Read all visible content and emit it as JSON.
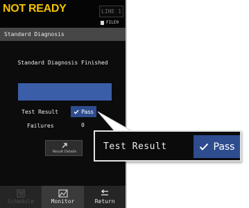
{
  "header": {
    "status_title": "NOT READY",
    "line_badge": "LINE 1",
    "file_indicator": "FILE0"
  },
  "section": {
    "title": "Standard Diagnosis"
  },
  "main": {
    "message": "Standard Diagnosis Finished",
    "progress": 1.0,
    "test_result_label": "Test Result",
    "test_result_value": "Pass",
    "failures_label": "Failures",
    "failures_value": "0",
    "details_button_label": "Result Details"
  },
  "bottom_nav": {
    "schedule_label": "Schedule",
    "monitor_label": "Monitor",
    "return_label": "Return"
  },
  "callout": {
    "label": "Test Result",
    "value": "Pass"
  },
  "colors": {
    "status_yellow": "#f2c300",
    "pass_blue": "#2e4d8f",
    "progress_blue": "#3b5ea8",
    "header_gray": "#474747"
  },
  "icons": {
    "file": "file-icon",
    "check": "check-icon",
    "details": "arrow-up-right-icon",
    "schedule": "schedule-icon",
    "monitor": "monitor-icon",
    "return": "return-icon"
  }
}
